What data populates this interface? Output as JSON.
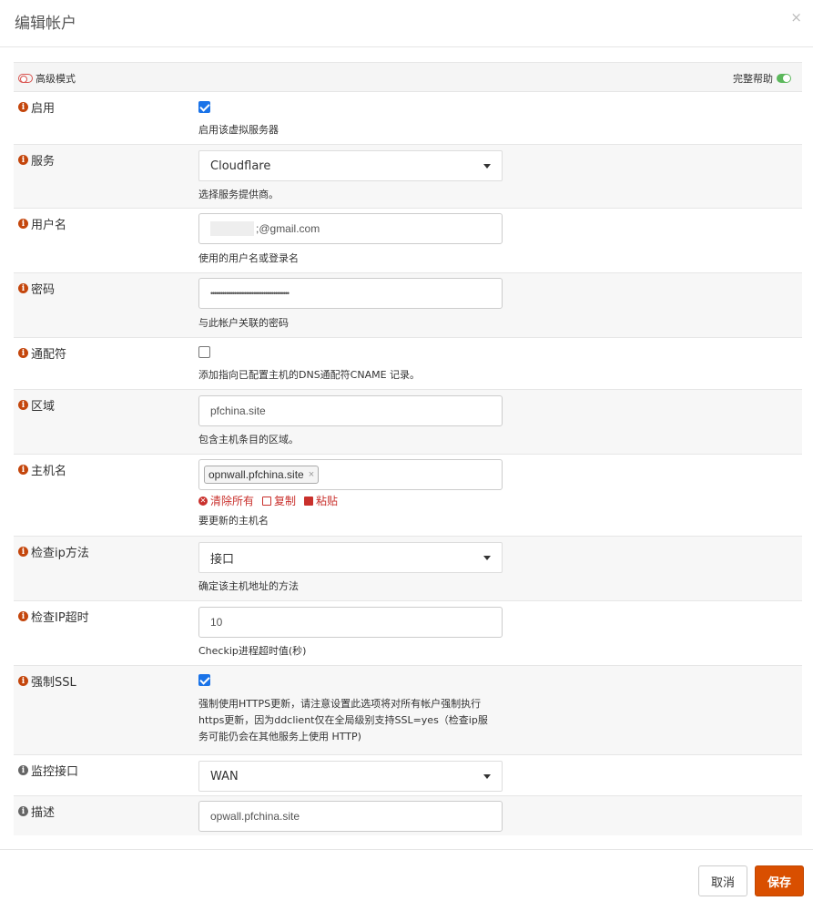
{
  "modal": {
    "title": "编辑帐户",
    "close": "×"
  },
  "top_bar": {
    "advanced_label": "高级模式",
    "full_help_label": "完整帮助"
  },
  "fields": {
    "enabled": {
      "label": "启用",
      "checked": true,
      "hint": "启用该虚拟服务器"
    },
    "service": {
      "label": "服务",
      "value": "Cloudflare",
      "hint": "选择服务提供商。"
    },
    "username": {
      "label": "用户名",
      "value": ";@gmail.com",
      "hint": "使用的用户名或登录名"
    },
    "password": {
      "label": "密码",
      "value": "••••••••••••••••••••••••••••••••••••••••",
      "hint": "与此帐户关联的密码"
    },
    "wildcard": {
      "label": "通配符",
      "checked": false,
      "hint": "添加指向已配置主机的DNS通配符CNAME 记录。"
    },
    "zone": {
      "label": "区域",
      "value": "pfchina.site",
      "hint": "包含主机条目的区域。"
    },
    "hostname": {
      "label": "主机名",
      "tags": [
        "opnwall.pfchina.site"
      ],
      "tag_remove": "×",
      "actions": {
        "clear": "清除所有",
        "copy": "复制",
        "paste": "粘贴"
      },
      "hint": "要更新的主机名"
    },
    "check_ip_method": {
      "label": "检查ip方法",
      "value": "接口",
      "hint": "确定该主机地址的方法"
    },
    "check_ip_timeout": {
      "label": "检查IP超时",
      "value": "10",
      "hint": "Checkip进程超时值(秒)"
    },
    "force_ssl": {
      "label": "强制SSL",
      "checked": true,
      "hint_lines": [
        "强制使用HTTPS更新，请注意设置此选项将对所有帐户强制执行",
        "https更新，因为ddclient仅在全局级别支持SSL=yes（检查ip服",
        "务可能仍会在其他服务上使用 HTTP)"
      ]
    },
    "monitor_interface": {
      "label": "监控接口",
      "value": "WAN"
    },
    "description": {
      "label": "描述",
      "value": "opwall.pfchina.site"
    }
  },
  "footer": {
    "cancel_label": "取消",
    "save_label": "保存"
  },
  "colors": {
    "accent": "#d94f00",
    "info_icon": "#c4460c",
    "danger": "#c9302c",
    "toggle_on": "#5cb85c",
    "checkbox": "#1a73e8"
  },
  "icons": [
    "info-icon",
    "close-icon",
    "toggle-off-icon",
    "toggle-on-icon",
    "chevron-down-icon",
    "clear-icon",
    "copy-icon",
    "paste-icon"
  ]
}
